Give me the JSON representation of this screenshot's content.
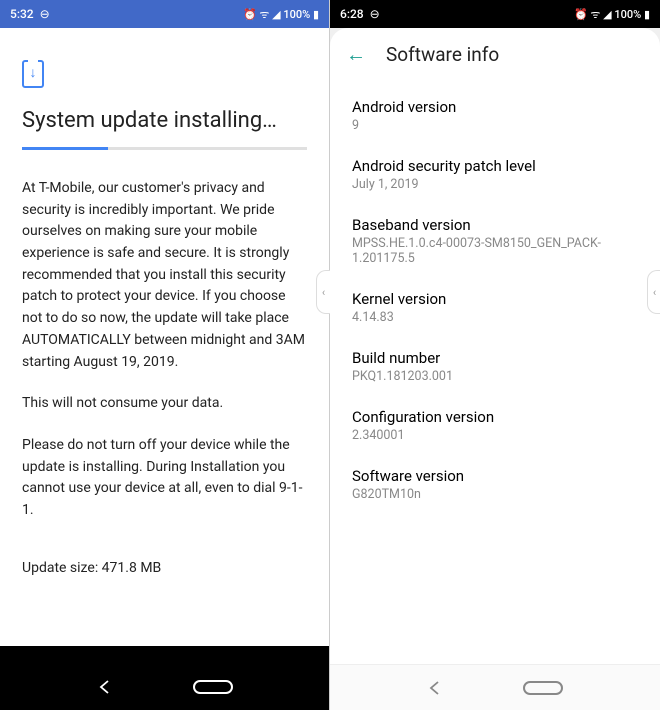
{
  "left": {
    "status": {
      "time": "5:32",
      "dnd": "⊖",
      "icons": "⏰ ᯤ ◢ 100% ▮"
    },
    "title": "System update installing…",
    "paragraph1": "At T-Mobile, our customer's privacy and security is incredibly important. We pride ourselves on making sure your mobile experience is safe and secure. It is strongly recommended that you install this security patch to protect your device. If you choose not to do so now, the update will take place AUTOMATICALLY between midnight and 3AM starting August 19, 2019.",
    "paragraph2": "This will not consume your data.",
    "paragraph3": "Please do not turn off your device while the update is installing. During Installation you cannot use your device at all, even to dial 9-1-1.",
    "size": "Update size: 471.8 MB"
  },
  "right": {
    "status": {
      "time": "6:28",
      "dnd": "⊖",
      "icons": "⏰ ᯤ ◢ 100% ▮"
    },
    "header": "Software info",
    "items": [
      {
        "label": "Android version",
        "value": "9"
      },
      {
        "label": "Android security patch level",
        "value": "July 1, 2019"
      },
      {
        "label": "Baseband version",
        "value": "MPSS.HE.1.0.c4-00073-SM8150_GEN_PACK-1.201175.5"
      },
      {
        "label": "Kernel version",
        "value": "4.14.83"
      },
      {
        "label": "Build number",
        "value": "PKQ1.181203.001"
      },
      {
        "label": "Configuration version",
        "value": "2.340001"
      },
      {
        "label": "Software version",
        "value": "G820TM10n"
      }
    ]
  }
}
